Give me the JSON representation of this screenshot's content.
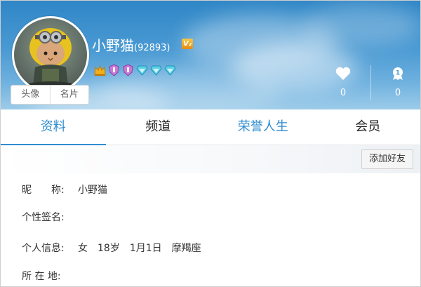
{
  "profile": {
    "nickname": "小野猫",
    "uid": "(92893)",
    "vip_level": "V₂",
    "avatar_tabs": [
      "头像",
      "名片"
    ],
    "stats": {
      "likes": "0",
      "rank": "0"
    }
  },
  "tabs": [
    "资料",
    "频道",
    "荣誉人生",
    "会员"
  ],
  "actions": {
    "add_friend": "添加好友"
  },
  "info": {
    "nickname_label": "昵　　称:",
    "nickname_value": "小野猫",
    "signature_label": "个性签名:",
    "personal_label": "个人信息:",
    "personal_values": [
      "女",
      "18岁",
      "1月1日",
      "摩羯座"
    ],
    "location_label": "所 在 地:"
  },
  "colors": {
    "accent": "#2f8cd0",
    "header_top": "#2f86c6",
    "header_bottom": "#9ccbe9"
  }
}
